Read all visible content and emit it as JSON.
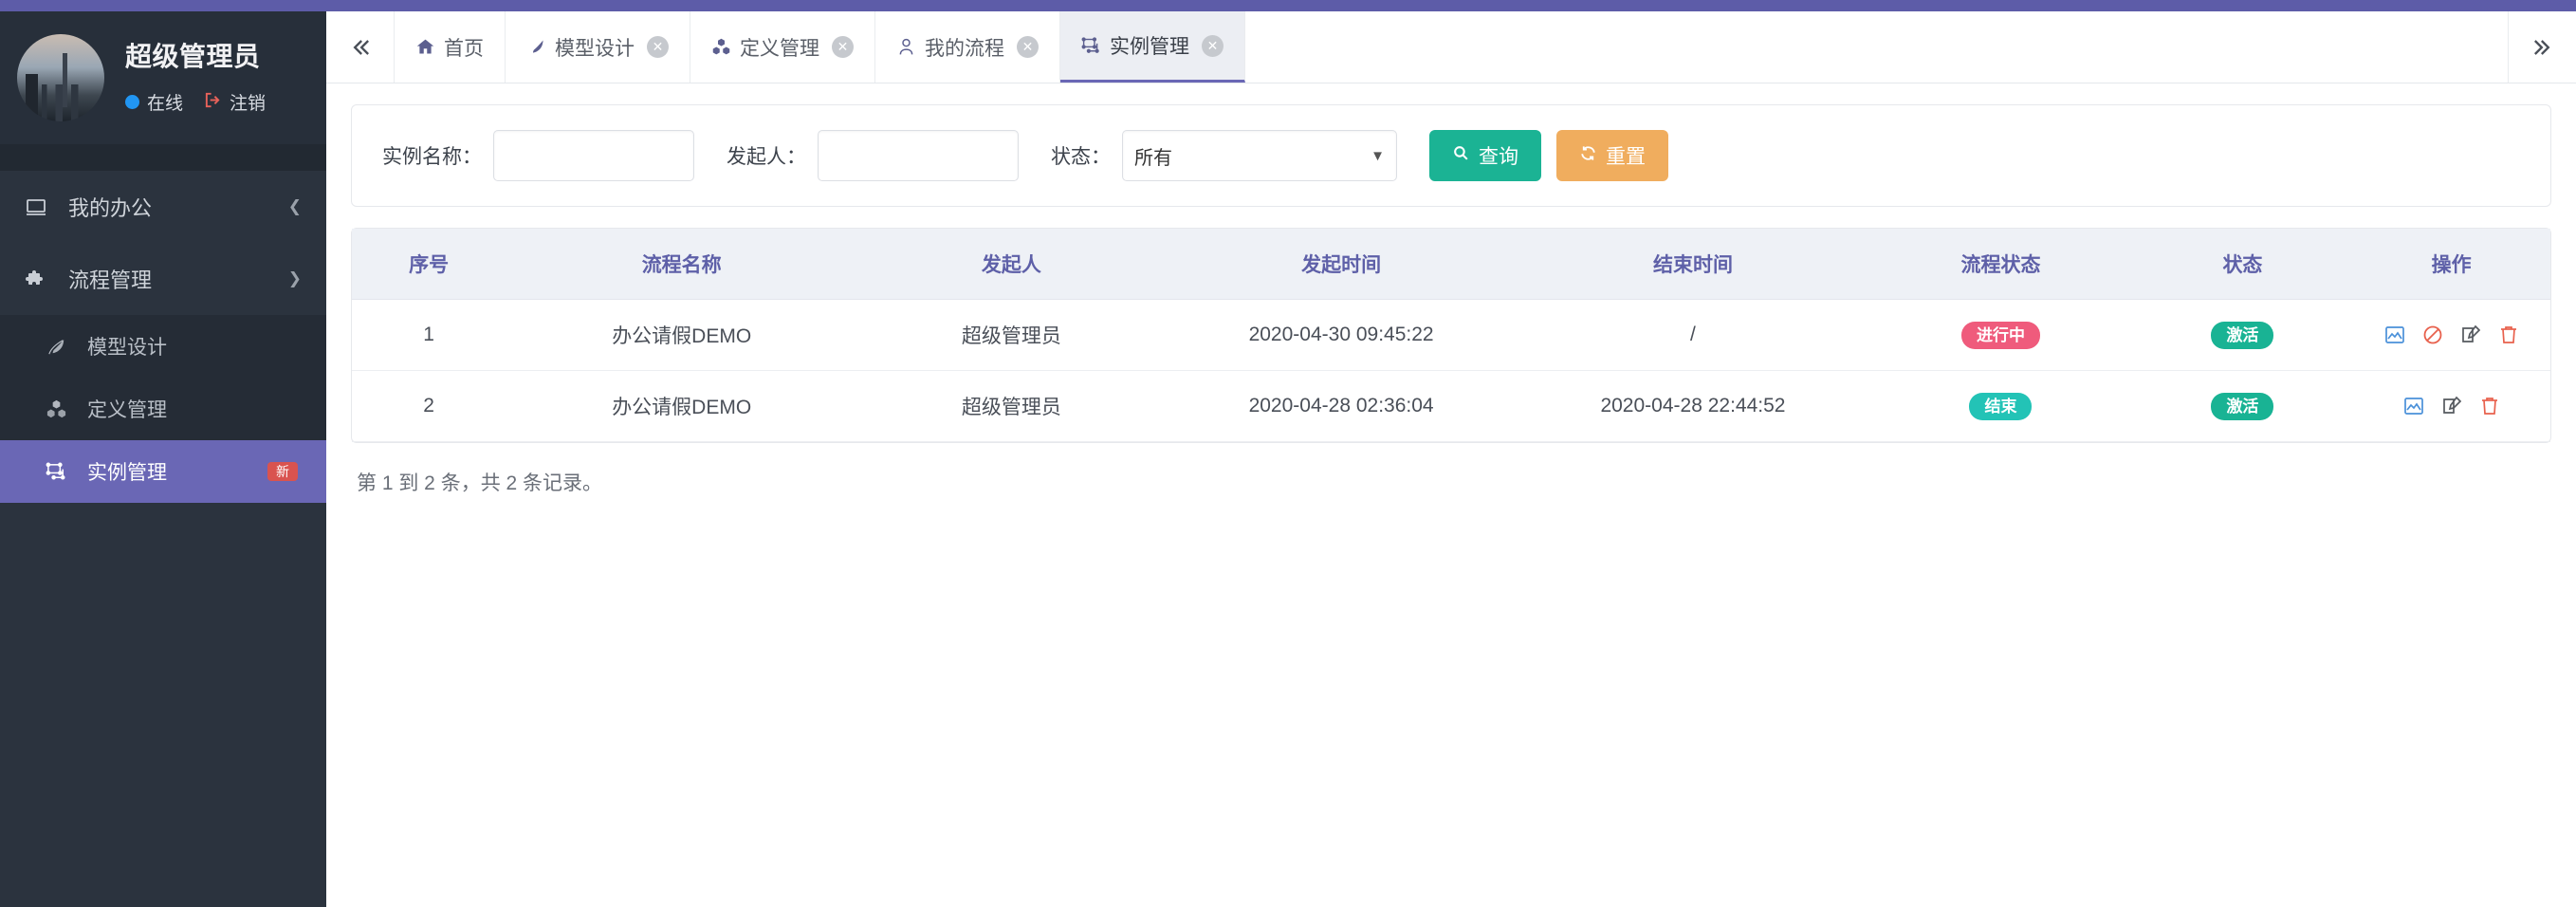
{
  "sidebar": {
    "profile": {
      "name": "超级管理员",
      "status_label": "在线",
      "logout_label": "注销",
      "avatar_icon": "user-avatar-photo"
    },
    "menu": [
      {
        "label": "我的办公",
        "icon": "monitor-icon",
        "arrow": "chevron-left-icon"
      },
      {
        "label": "流程管理",
        "icon": "puzzle-icon",
        "arrow": "chevron-down-icon"
      }
    ],
    "submenu": [
      {
        "label": "模型设计",
        "icon": "leaf-icon",
        "active": false,
        "badge": ""
      },
      {
        "label": "定义管理",
        "icon": "cubes-icon",
        "active": false,
        "badge": ""
      },
      {
        "label": "实例管理",
        "icon": "instance-icon",
        "active": true,
        "badge": "新"
      }
    ]
  },
  "tabbar": {
    "collapse_icon": "chevron-double-left-icon",
    "expand_icon": "chevron-double-right-icon",
    "tabs": [
      {
        "label": "首页",
        "icon": "home-icon",
        "closable": false,
        "active": false
      },
      {
        "label": "模型设计",
        "icon": "leaf-icon",
        "closable": true,
        "active": false
      },
      {
        "label": "定义管理",
        "icon": "cubes-icon",
        "closable": true,
        "active": false
      },
      {
        "label": "我的流程",
        "icon": "user-icon",
        "closable": true,
        "active": false
      },
      {
        "label": "实例管理",
        "icon": "instance-icon",
        "closable": true,
        "active": true
      }
    ]
  },
  "filter": {
    "instance_name_label": "实例名称：",
    "instance_name_value": "",
    "instance_name_placeholder": "",
    "initiator_label": "发起人：",
    "initiator_value": "",
    "initiator_placeholder": "",
    "status_label": "状态：",
    "status_value": "所有",
    "status_options": [
      "所有"
    ],
    "search_button": "查询",
    "search_icon": "search-icon",
    "reset_button": "重置",
    "reset_icon": "refresh-icon"
  },
  "table": {
    "headers": [
      "序号",
      "流程名称",
      "发起人",
      "发起时间",
      "结束时间",
      "流程状态",
      "状态",
      "操作"
    ],
    "rows": [
      {
        "index": "1",
        "name": "办公请假DEMO",
        "initiator": "超级管理员",
        "start_time": "2020-04-30 09:45:22",
        "end_time": "/",
        "process_status": "进行中",
        "process_status_color": "#ef5b7c",
        "status": "激活",
        "status_color": "#19b394",
        "ops": [
          "image-icon",
          "ban-icon",
          "edit-icon",
          "delete-icon"
        ]
      },
      {
        "index": "2",
        "name": "办公请假DEMO",
        "initiator": "超级管理员",
        "start_time": "2020-04-28 02:36:04",
        "end_time": "2020-04-28 22:44:52",
        "process_status": "结束",
        "process_status_color": "#23c3b6",
        "status": "激活",
        "status_color": "#19b394",
        "ops": [
          "image-icon",
          "edit-icon",
          "delete-icon"
        ]
      }
    ],
    "footer": "第 1 到 2 条，共 2 条记录。"
  },
  "theme": {
    "accent": "#6a67b5",
    "sidebar_bg": "#2b333e",
    "header_purple": "#5d5ca8"
  }
}
